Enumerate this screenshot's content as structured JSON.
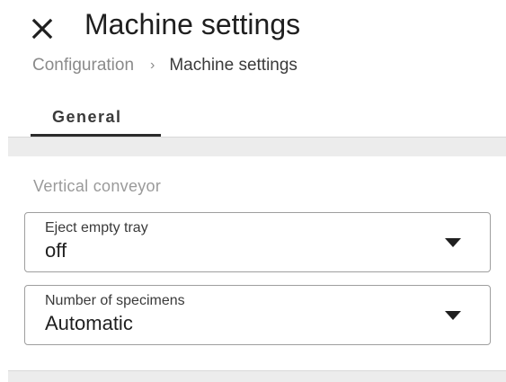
{
  "header": {
    "title": "Machine settings",
    "close_icon": "close-icon"
  },
  "breadcrumb": {
    "parent": "Configuration",
    "separator": "›",
    "current": "Machine settings"
  },
  "tabs": [
    {
      "label": "General",
      "active": true
    }
  ],
  "section": {
    "title": "Vertical conveyor",
    "fields": [
      {
        "label": "Eject empty tray",
        "value": "off",
        "icon": "dropdown-arrow-icon"
      },
      {
        "label": "Number of specimens",
        "value": "Automatic",
        "icon": "dropdown-arrow-icon"
      }
    ]
  },
  "colors": {
    "text": "#1f1f1f",
    "muted": "#8a8a8a",
    "band": "#ececec",
    "field_border": "#9e9e9e",
    "tab_indicator": "#2b2b2b"
  }
}
